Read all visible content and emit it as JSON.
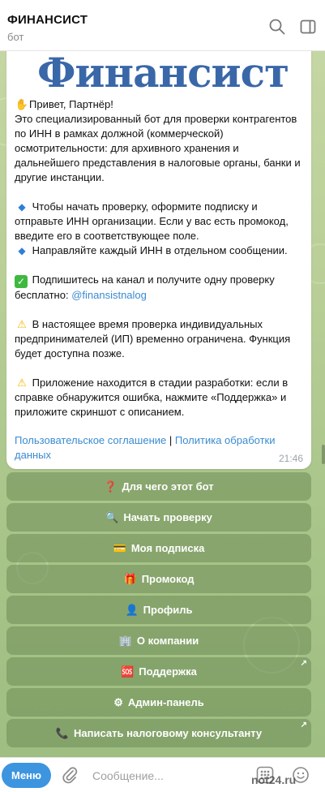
{
  "header": {
    "title": "ФИНАНСИСТ",
    "subtitle": "бот"
  },
  "message": {
    "logo_text": "Финансист",
    "greeting": "Привет, Партнёр!",
    "intro": "Это специализированный бот для проверки контрагентов по ИНН в рамках должной (коммерческой) осмотрительности: для архивного хранения и дальнейшего представления в налоговые органы, банки и другие инстанции.",
    "step1": "Чтобы начать проверку, оформите подписку и отправьте ИНН организации. Если у вас есть промокод, введите его в соответствующее поле.",
    "step2": "Направляйте каждый ИНН в отдельном сообщении.",
    "subscribe": "Подпишитесь на канал и получите одну проверку бесплатно: ",
    "channel": "@finansistnalog",
    "warning1": "В настоящее время проверка индивидуальных предпринимателей (ИП) временно ограничена. Функция будет доступна позже.",
    "warning2": "Приложение находится в стадии разработки: если в справке обнаружится ошибка, нажмите «Поддержка» и приложите скриншот с описанием.",
    "link_agreement": "Пользовательское соглашение",
    "separator": "|",
    "link_privacy": "Политика обработки данных",
    "time": "21:46"
  },
  "keyboard": [
    {
      "icon": "❓",
      "label": "Для чего этот бот"
    },
    {
      "icon": "🔍",
      "label": "Начать проверку"
    },
    {
      "icon": "💳",
      "label": "Моя подписка"
    },
    {
      "icon": "🎁",
      "label": "Промокод"
    },
    {
      "icon": "👤",
      "label": "Профиль"
    },
    {
      "icon": "🏢",
      "label": "О компании"
    },
    {
      "icon": "🆘",
      "label": "Поддержка"
    },
    {
      "icon": "⚙",
      "label": "Админ-панель"
    },
    {
      "icon": "📞",
      "label": "Написать налоговому консультанту"
    }
  ],
  "input": {
    "menu_label": "Меню",
    "placeholder": "Сообщение..."
  },
  "watermark": "not24.ru",
  "colors": {
    "accent": "#3d95e0",
    "link": "#3a8bd0",
    "logo": "#3a67a8",
    "background": "#b9cf97"
  }
}
